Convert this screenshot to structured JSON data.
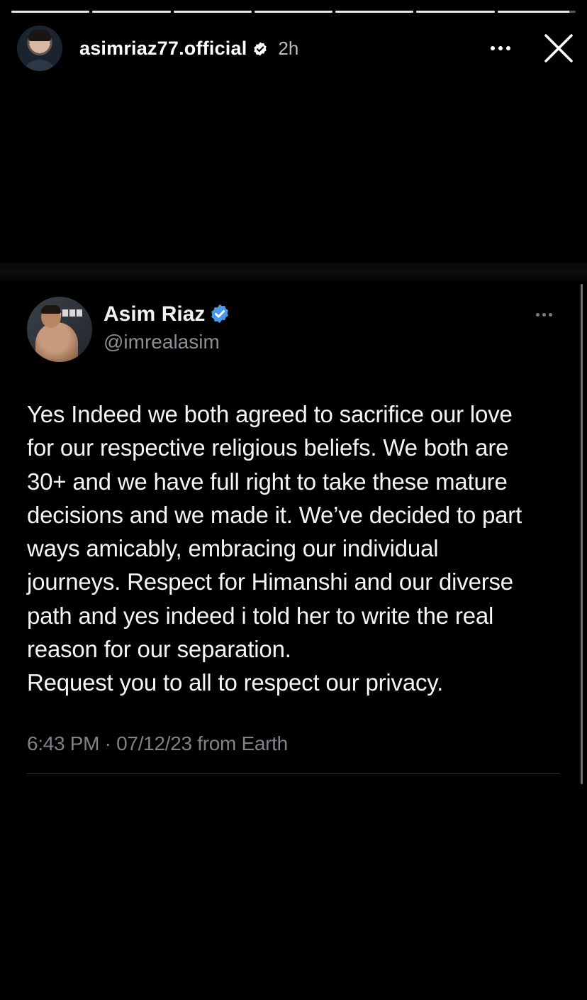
{
  "story": {
    "progress_segments": [
      1,
      1,
      1,
      1,
      1,
      1,
      0.92
    ],
    "username": "asimriaz77.official",
    "time_ago": "2h",
    "verified_icon": "verified-badge-icon",
    "more_icon": "more-horizontal-icon",
    "close_icon": "close-icon"
  },
  "tweet": {
    "author_name": "Asim Riaz",
    "handle": "@imrealasim",
    "verified_color": "#4a99e9",
    "body": "Yes Indeed we both agreed to sacrifice our love\nfor our respective religious beliefs. We both are\n30+ and we have full right to  take these mature\ndecisions and we made it. We’ve decided to part\nways amicably, embracing our individual\njourneys. Respect for Himanshi and our diverse\npath and yes indeed i told her to write the real\nreason for our separation.\nRequest you to all to respect our privacy.",
    "meta": "6:43 PM · 07/12/23 from Earth"
  }
}
